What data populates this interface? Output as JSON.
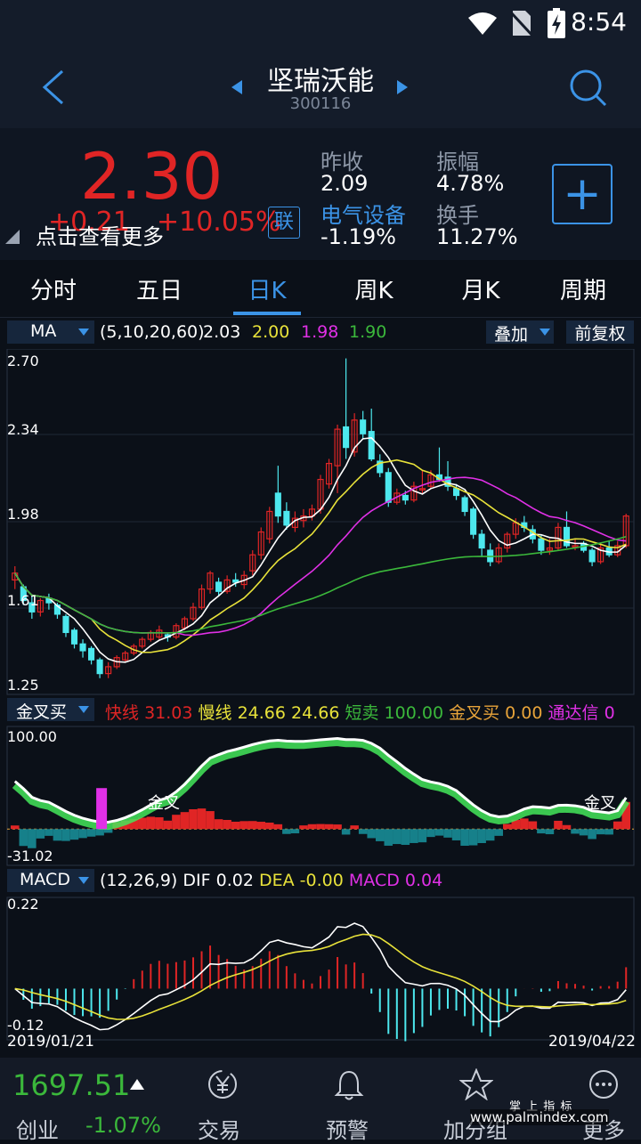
{
  "status": {
    "time": "8:54"
  },
  "header": {
    "title": "坚瑞沃能",
    "code": "300116"
  },
  "quote": {
    "price": "2.30",
    "change": "+0.21",
    "change_pct": "+10.05%",
    "more_tip": "点击查看更多",
    "badge": "联",
    "prev_close_label": "昨收",
    "prev_close": "2.09",
    "amplitude_label": "振幅",
    "amplitude": "4.78%",
    "sector_label": "电气设备",
    "sector_change": "-1.19%",
    "turnover_label": "换手",
    "turnover": "11.27%",
    "add_label": "+"
  },
  "tabs": [
    {
      "label": "分时"
    },
    {
      "label": "五日"
    },
    {
      "label": "日K"
    },
    {
      "label": "周K"
    },
    {
      "label": "月K"
    },
    {
      "label": "周期"
    }
  ],
  "ma_bar": {
    "selector": "MA",
    "params": "(5,10,20,60)",
    "v1": "2.03",
    "v2": "2.00",
    "v3": "1.98",
    "v4": "1.90",
    "overlay": "叠加",
    "adjust": "前复权"
  },
  "price_axis": [
    "2.70",
    "2.34",
    "1.98",
    "1.61",
    "1.25"
  ],
  "ind_bar": {
    "selector": "金叉买",
    "fast_label": "快线",
    "fast": "31.03",
    "slow_label": "慢线",
    "slow": "24.66",
    "v3": "24.66",
    "short_label": "短卖",
    "short_val": "100.00",
    "gold_label": "金叉买",
    "gold_val": "0.00",
    "tdx_label": "通达信",
    "tdx_val": "0"
  },
  "ind_axis": {
    "top": "100.00",
    "bottom": "-31.02"
  },
  "ind_marks": {
    "left": "金叉",
    "right": "金叉"
  },
  "macd_bar": {
    "selector": "MACD",
    "params": "(12,26,9)",
    "dif_label": "DIF",
    "dif": "0.02",
    "dea_label": "DEA",
    "dea": "-0.00",
    "macd_label": "MACD",
    "macd": "0.04"
  },
  "macd_axis": {
    "top": "0.22",
    "bottom": "-0.12"
  },
  "dates": {
    "start": "2019/01/21",
    "end": "2019/04/22"
  },
  "bottom": {
    "index_value": "1697.51",
    "index_name": "创业",
    "index_change": "-1.07%",
    "nav": [
      {
        "label": "交易",
        "icon": "yen-cycle-icon"
      },
      {
        "label": "预警",
        "icon": "bell-icon"
      },
      {
        "label": "加分组",
        "icon": "star-icon"
      },
      {
        "label": "更多",
        "icon": "more-icon"
      }
    ]
  },
  "watermark": {
    "line1": "掌 上 指 标",
    "line2": "www.palmindex.com"
  },
  "colors": {
    "up": "#e02525",
    "down": "#4de8ee",
    "ma5": "#ffffff",
    "ma10": "#e8e23a",
    "ma20": "#e030e6",
    "ma60": "#3bb83b",
    "accent": "#3b93e6"
  },
  "chart_data": {
    "type": "candlestick",
    "y_range": [
      1.25,
      2.7
    ],
    "candles": [
      [
        1.72,
        1.75,
        1.78,
        1.68
      ],
      [
        1.69,
        1.63,
        1.7,
        1.61
      ],
      [
        1.62,
        1.58,
        1.65,
        1.55
      ],
      [
        1.58,
        1.63,
        1.64,
        1.56
      ],
      [
        1.64,
        1.62,
        1.66,
        1.59
      ],
      [
        1.61,
        1.57,
        1.62,
        1.55
      ],
      [
        1.56,
        1.49,
        1.57,
        1.47
      ],
      [
        1.5,
        1.44,
        1.51,
        1.42
      ],
      [
        1.44,
        1.41,
        1.46,
        1.38
      ],
      [
        1.42,
        1.37,
        1.43,
        1.35
      ],
      [
        1.37,
        1.31,
        1.38,
        1.29
      ],
      [
        1.31,
        1.34,
        1.36,
        1.29
      ],
      [
        1.34,
        1.38,
        1.39,
        1.33
      ],
      [
        1.37,
        1.4,
        1.41,
        1.36
      ],
      [
        1.4,
        1.43,
        1.44,
        1.39
      ],
      [
        1.43,
        1.46,
        1.47,
        1.42
      ],
      [
        1.46,
        1.49,
        1.5,
        1.45
      ],
      [
        1.47,
        1.5,
        1.52,
        1.46
      ],
      [
        1.48,
        1.47,
        1.49,
        1.45
      ],
      [
        1.47,
        1.52,
        1.53,
        1.46
      ],
      [
        1.51,
        1.55,
        1.56,
        1.5
      ],
      [
        1.55,
        1.6,
        1.62,
        1.54
      ],
      [
        1.6,
        1.68,
        1.7,
        1.59
      ],
      [
        1.68,
        1.75,
        1.76,
        1.66
      ],
      [
        1.71,
        1.67,
        1.73,
        1.65
      ],
      [
        1.67,
        1.72,
        1.74,
        1.66
      ],
      [
        1.72,
        1.71,
        1.75,
        1.69
      ],
      [
        1.7,
        1.74,
        1.76,
        1.68
      ],
      [
        1.76,
        1.83,
        1.85,
        1.74
      ],
      [
        1.83,
        1.93,
        1.95,
        1.81
      ],
      [
        1.9,
        2.02,
        2.04,
        1.88
      ],
      [
        2.1,
        2.0,
        2.22,
        1.97
      ],
      [
        2.02,
        1.96,
        2.06,
        1.94
      ],
      [
        1.95,
        1.99,
        2.02,
        1.93
      ],
      [
        1.98,
        2.0,
        2.03,
        1.95
      ],
      [
        2.0,
        2.03,
        2.05,
        1.98
      ],
      [
        2.03,
        2.16,
        2.18,
        2.01
      ],
      [
        2.14,
        2.23,
        2.25,
        2.12
      ],
      [
        2.22,
        2.38,
        2.4,
        2.1
      ],
      [
        2.39,
        2.3,
        2.69,
        2.25
      ],
      [
        2.28,
        2.42,
        2.45,
        2.26
      ],
      [
        2.42,
        2.36,
        2.46,
        2.34
      ],
      [
        2.37,
        2.25,
        2.47,
        2.24
      ],
      [
        2.24,
        2.19,
        2.27,
        2.17
      ],
      [
        2.19,
        2.06,
        2.21,
        2.04
      ],
      [
        2.06,
        2.1,
        2.12,
        2.05
      ],
      [
        2.09,
        2.07,
        2.11,
        2.05
      ],
      [
        2.07,
        2.13,
        2.15,
        2.06
      ],
      [
        2.12,
        2.12,
        2.2,
        2.1
      ],
      [
        2.13,
        2.18,
        2.2,
        2.12
      ],
      [
        2.18,
        2.16,
        2.3,
        2.15
      ],
      [
        2.17,
        2.13,
        2.24,
        2.11
      ],
      [
        2.12,
        2.09,
        2.14,
        2.07
      ],
      [
        2.08,
        2.02,
        2.09,
        2.0
      ],
      [
        2.03,
        1.92,
        2.04,
        1.9
      ],
      [
        1.92,
        1.86,
        1.94,
        1.82
      ],
      [
        1.85,
        1.8,
        1.88,
        1.78
      ],
      [
        1.8,
        1.86,
        1.88,
        1.79
      ],
      [
        1.86,
        1.92,
        1.93,
        1.84
      ],
      [
        1.92,
        1.97,
        1.99,
        1.9
      ],
      [
        1.97,
        1.95,
        2.0,
        1.93
      ],
      [
        1.94,
        1.9,
        1.96,
        1.88
      ],
      [
        1.9,
        1.85,
        1.92,
        1.83
      ],
      [
        1.85,
        1.86,
        1.9,
        1.83
      ],
      [
        1.86,
        1.95,
        1.97,
        1.85
      ],
      [
        1.95,
        1.87,
        2.02,
        1.86
      ],
      [
        1.87,
        1.87,
        1.9,
        1.85
      ],
      [
        1.88,
        1.85,
        1.89,
        1.84
      ],
      [
        1.85,
        1.8,
        1.86,
        1.78
      ],
      [
        1.8,
        1.86,
        1.88,
        1.79
      ],
      [
        1.86,
        1.83,
        1.89,
        1.82
      ],
      [
        1.83,
        1.87,
        1.89,
        1.82
      ],
      [
        1.87,
        2.0,
        2.01,
        1.86
      ]
    ],
    "ma_series": [
      "MA5",
      "MA10",
      "MA20",
      "MA60"
    ]
  }
}
